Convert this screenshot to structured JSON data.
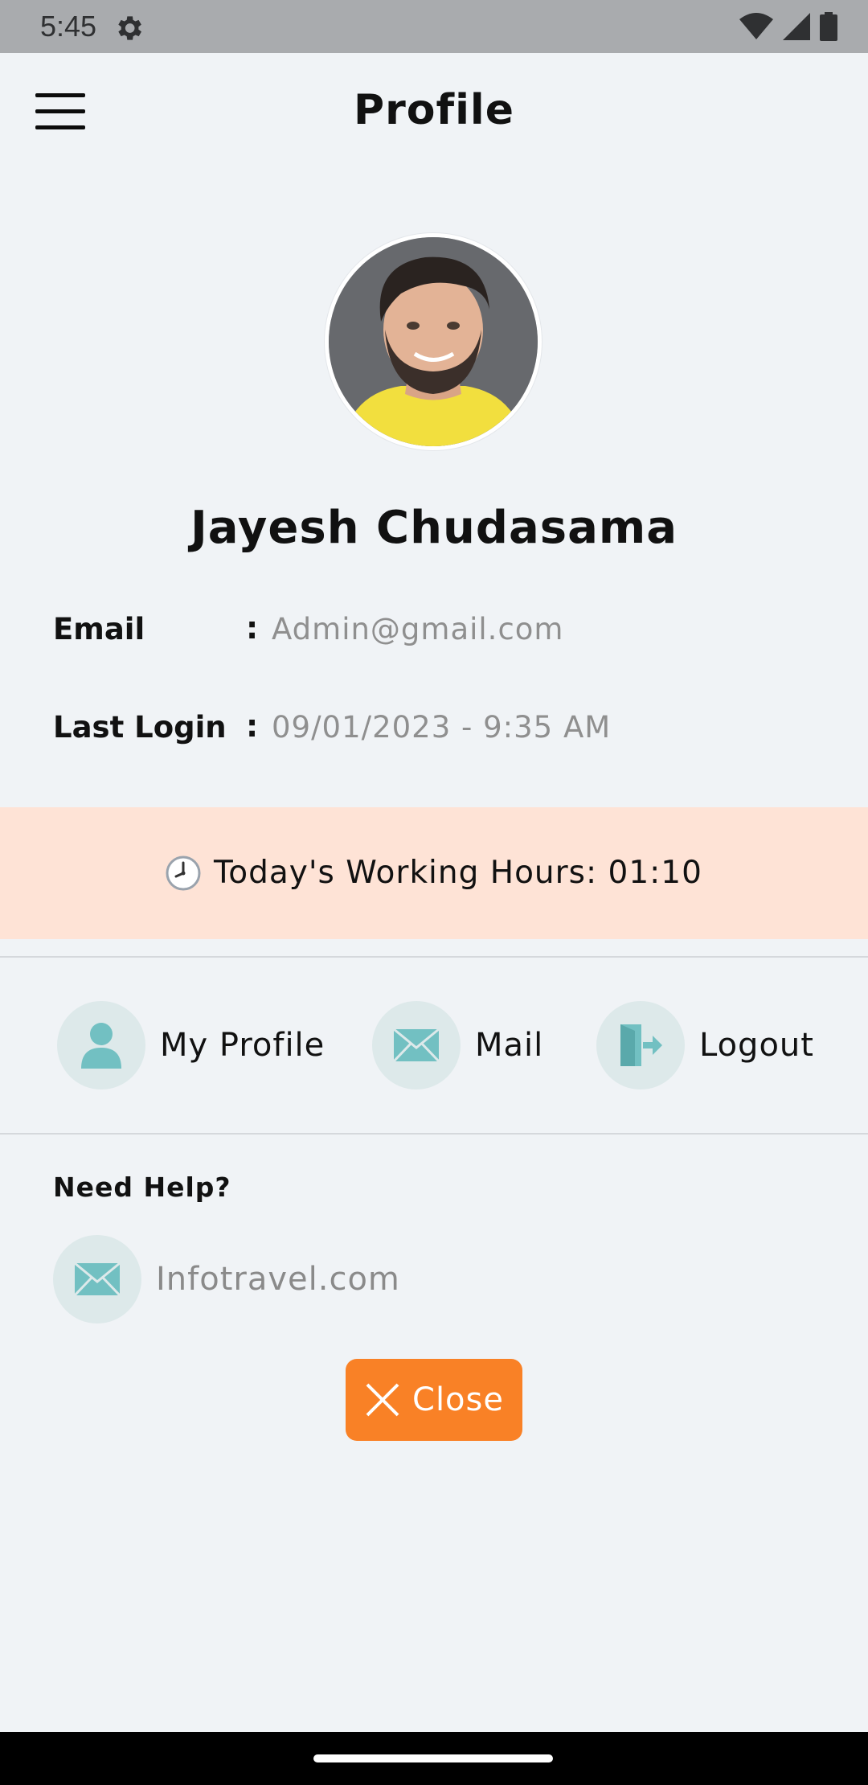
{
  "status_bar": {
    "time": "5:45",
    "icons": [
      "settings-gear-icon",
      "wifi-icon",
      "signal-icon",
      "battery-icon"
    ]
  },
  "header": {
    "title": "Profile",
    "menu_icon": "hamburger-menu-icon"
  },
  "profile": {
    "name": "Jayesh Chudasama",
    "fields": [
      {
        "label": "Email",
        "separator": ":",
        "value": "Admin@gmail.com"
      },
      {
        "label": "Last Login",
        "separator": ":",
        "value": "09/01/2023 - 9:35 AM"
      }
    ]
  },
  "working_hours": {
    "icon": "clock-icon",
    "text": "Today's Working Hours: 01:10",
    "background": "#fee3d6"
  },
  "actions": [
    {
      "label": "My Profile",
      "icon": "user-icon"
    },
    {
      "label": "Mail",
      "icon": "mail-icon"
    },
    {
      "label": "Logout",
      "icon": "logout-icon"
    }
  ],
  "help": {
    "title": "Need Help?",
    "link_label": "Infotravel.com",
    "link_icon": "mail-icon"
  },
  "close_button": {
    "label": "Close",
    "icon": "close-icon",
    "color": "#f98126"
  },
  "colors": {
    "accent_teal": "#72c0c2",
    "icon_circle_bg": "#dde9ea",
    "muted_text": "#8f8f8f",
    "page_background": "#f0f3f6"
  }
}
